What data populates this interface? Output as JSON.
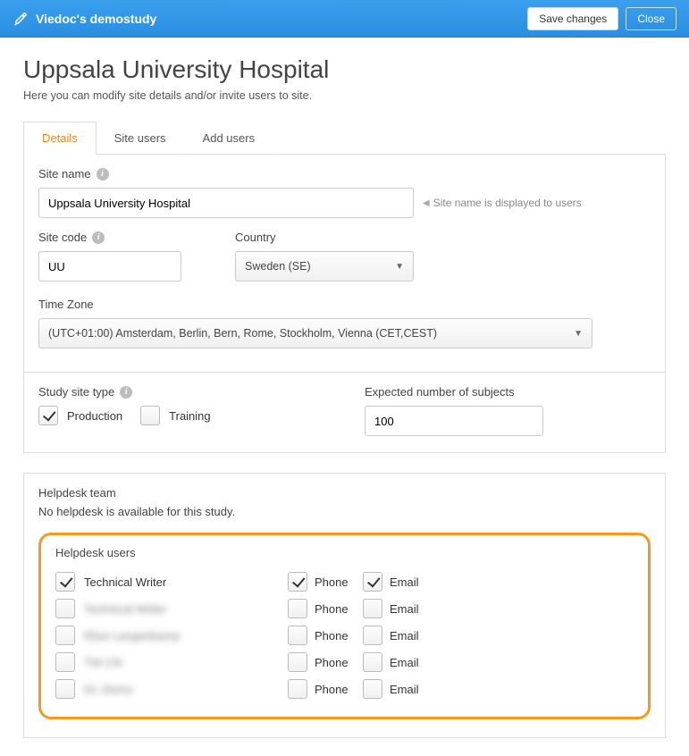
{
  "header": {
    "title": "Viedoc's demostudy",
    "save_label": "Save changes",
    "close_label": "Close"
  },
  "page": {
    "title": "Uppsala University Hospital",
    "subtitle": "Here you can modify site details and/or invite users to site."
  },
  "tabs": {
    "details": "Details",
    "site_users": "Site users",
    "add_users": "Add users"
  },
  "details": {
    "site_name_label": "Site name",
    "site_name_value": "Uppsala University Hospital",
    "site_name_hint": "Site name is displayed to users",
    "site_code_label": "Site code",
    "site_code_value": "UU",
    "country_label": "Country",
    "country_value": "Sweden (SE)",
    "timezone_label": "Time Zone",
    "timezone_value": "(UTC+01:00) Amsterdam, Berlin, Bern, Rome, Stockholm, Vienna (CET,CEST)",
    "study_site_type_label": "Study site type",
    "production_label": "Production",
    "training_label": "Training",
    "production_checked": true,
    "training_checked": false,
    "expected_label": "Expected number of subjects",
    "expected_value": "100"
  },
  "helpdesk": {
    "team_label": "Helpdesk team",
    "team_msg": "No helpdesk is available for this study.",
    "users_label": "Helpdesk users",
    "phone_label": "Phone",
    "email_label": "Email",
    "rows": [
      {
        "name": "Technical Writer",
        "checked": true,
        "phone": true,
        "email": true,
        "blurred": false
      },
      {
        "name": "Technical Writer",
        "checked": false,
        "phone": false,
        "email": false,
        "blurred": true
      },
      {
        "name": "Elise Langenkamp",
        "checked": false,
        "phone": false,
        "email": false,
        "blurred": true
      },
      {
        "name": "TW CN",
        "checked": false,
        "phone": false,
        "email": false,
        "blurred": true
      },
      {
        "name": "Dr. Demo",
        "checked": false,
        "phone": false,
        "email": false,
        "blurred": true
      }
    ]
  }
}
